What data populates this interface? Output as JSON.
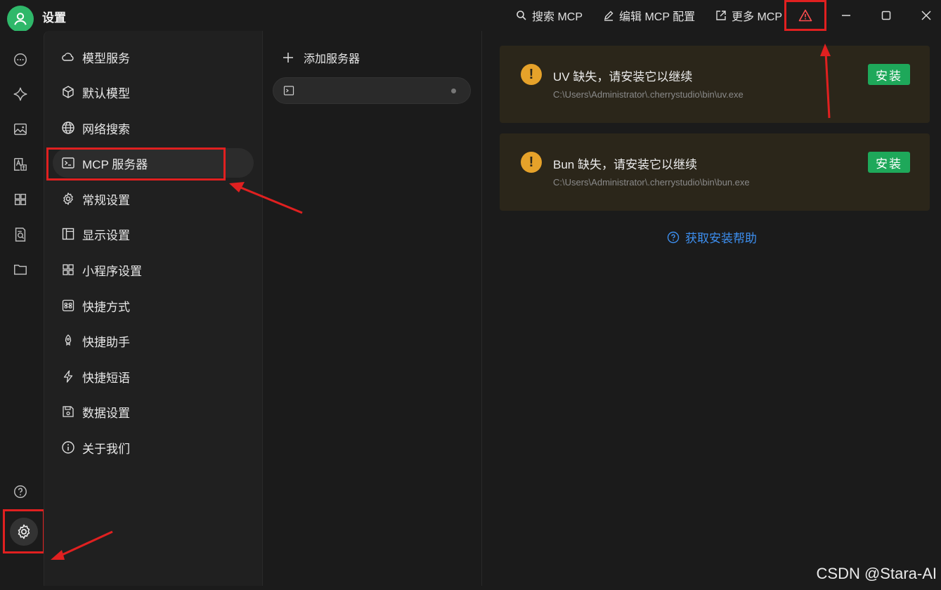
{
  "titlebar": {
    "title": "设置",
    "actions": [
      {
        "label": "搜索 MCP",
        "icon": "search-icon"
      },
      {
        "label": "编辑 MCP 配置",
        "icon": "edit-icon"
      },
      {
        "label": "更多 MCP",
        "icon": "external-link-icon"
      }
    ],
    "warning_icon": "warning-icon",
    "colors": {
      "avatar": "#2fb86a",
      "highlight": "#e02020"
    }
  },
  "rail": {
    "icons": [
      "chat-icon",
      "sparkle-icon",
      "image-icon",
      "translate-icon",
      "apps-icon",
      "file-search-icon",
      "folder-icon",
      "help-icon",
      "moon-icon",
      "settings-icon"
    ]
  },
  "menu": {
    "items": [
      {
        "label": "模型服务",
        "icon": "cloud-icon"
      },
      {
        "label": "默认模型",
        "icon": "cube-icon"
      },
      {
        "label": "网络搜索",
        "icon": "globe-icon"
      },
      {
        "label": "MCP 服务器",
        "icon": "terminal-icon",
        "active": true
      },
      {
        "label": "常规设置",
        "icon": "gear-icon"
      },
      {
        "label": "显示设置",
        "icon": "layout-icon"
      },
      {
        "label": "小程序设置",
        "icon": "apps-icon"
      },
      {
        "label": "快捷方式",
        "icon": "command-icon"
      },
      {
        "label": "快捷助手",
        "icon": "rocket-icon"
      },
      {
        "label": "快捷短语",
        "icon": "bolt-icon"
      },
      {
        "label": "数据设置",
        "icon": "save-icon"
      },
      {
        "label": "关于我们",
        "icon": "info-icon"
      }
    ]
  },
  "servers": {
    "add_label": "添加服务器"
  },
  "alerts": [
    {
      "title": "UV 缺失，请安装它以继续",
      "path": "C:\\Users\\Administrator\\.cherrystudio\\bin\\uv.exe",
      "button": "安装"
    },
    {
      "title": "Bun 缺失，请安装它以继续",
      "path": "C:\\Users\\Administrator\\.cherrystudio\\bin\\bun.exe",
      "button": "安装"
    }
  ],
  "help_link": "获取安装帮助",
  "watermark": "CSDN @Stara-AI"
}
